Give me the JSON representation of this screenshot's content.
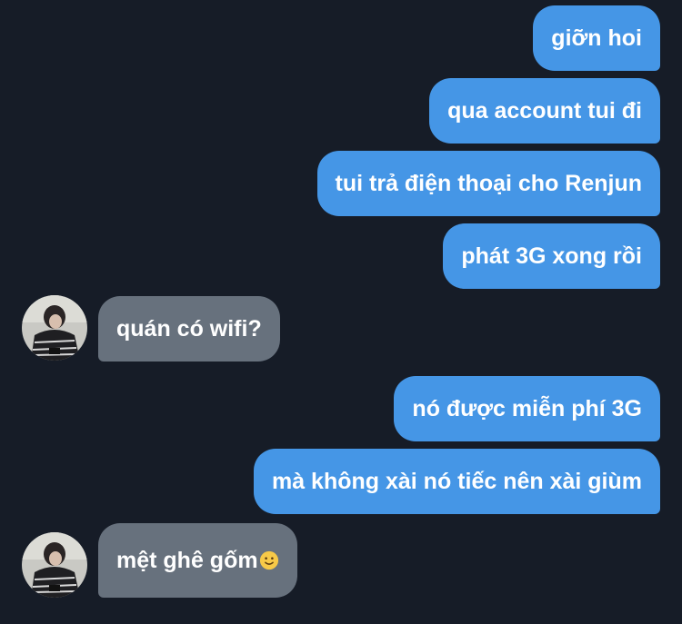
{
  "messages": [
    {
      "direction": "sent",
      "text": "giỡn hoi"
    },
    {
      "direction": "sent",
      "text": "qua account tui đi"
    },
    {
      "direction": "sent",
      "text": "tui trả điện thoại cho Renjun"
    },
    {
      "direction": "sent",
      "text": "phát 3G xong rồi"
    },
    {
      "direction": "received",
      "text": "quán có wifi?"
    },
    {
      "direction": "sent",
      "text": "nó được miễn phí 3G"
    },
    {
      "direction": "sent",
      "text": "mà không xài nó tiếc nên xài giùm"
    },
    {
      "direction": "received",
      "text": "mệt ghê gốm",
      "emoji": "slightly-smiling-face"
    }
  ],
  "colors": {
    "background": "#161c27",
    "sent_bubble": "#4596e6",
    "received_bubble": "#67717d",
    "text": "#ffffff"
  }
}
